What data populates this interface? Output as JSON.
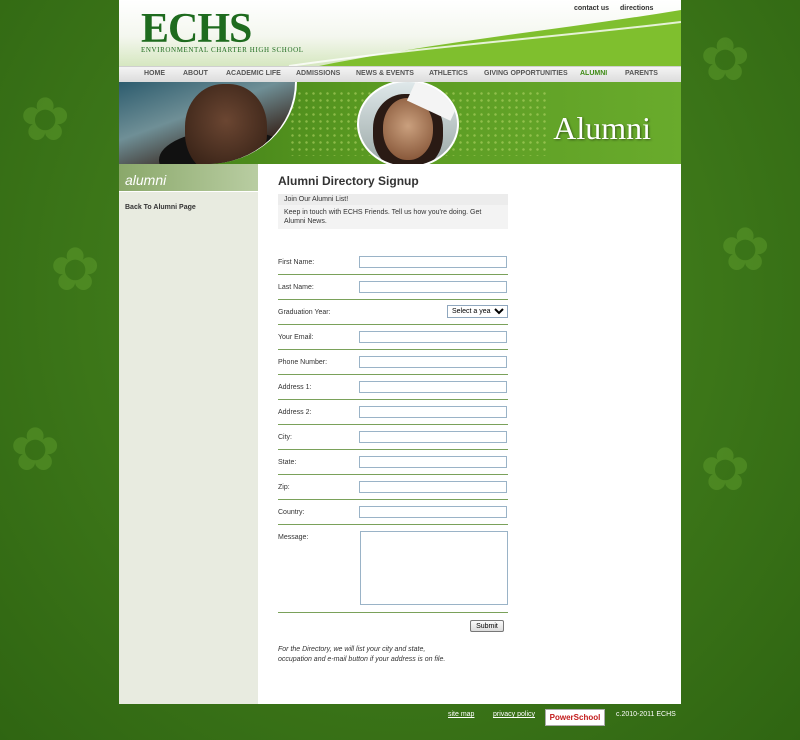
{
  "site": {
    "logo_text": "ECHS",
    "logo_sub": "ENVIRONMENTAL CHARTER HIGH SCHOOL",
    "top_links": [
      "contact us",
      "directions"
    ]
  },
  "nav": {
    "items": [
      "HOME",
      "ABOUT",
      "ACADEMIC LIFE",
      "ADMISSIONS",
      "NEWS & EVENTS",
      "ATHLETICS",
      "GIVING OPPORTUNITIES",
      "ALUMNI",
      "PARENTS"
    ],
    "active": "ALUMNI"
  },
  "banner": {
    "title": "Alumni"
  },
  "sidebar": {
    "heading": "alumni",
    "link": "Back To Alumni Page"
  },
  "main": {
    "title": "Alumni Directory Signup",
    "join": "Join Our Alumni List!",
    "intro": "Keep in touch with ECHS Friends. Tell us how you're doing. Get Alumni News.",
    "fields": {
      "first_name": "First Name:",
      "last_name": "Last Name:",
      "grad_year": "Graduation Year:",
      "email": "Your Email:",
      "phone": "Phone Number:",
      "address1": "Address 1:",
      "address2": "Address 2:",
      "city": "City:",
      "state": "State:",
      "zip": "Zip:",
      "country": "Country:",
      "message": "Message:"
    },
    "grad_year_selected": "Select a year",
    "submit": "Submit",
    "note_line1": "For the Directory, we will list your city and state,",
    "note_line2": "occupation and e-mail button if your address is on file."
  },
  "footer": {
    "site_map": "site map",
    "privacy": "privacy policy",
    "powerschool": "PowerSchool",
    "copyright": "c.2010-2011 ECHS"
  },
  "colors": {
    "brand_green": "#1e6b1e",
    "accent_green": "#3d8a14"
  }
}
